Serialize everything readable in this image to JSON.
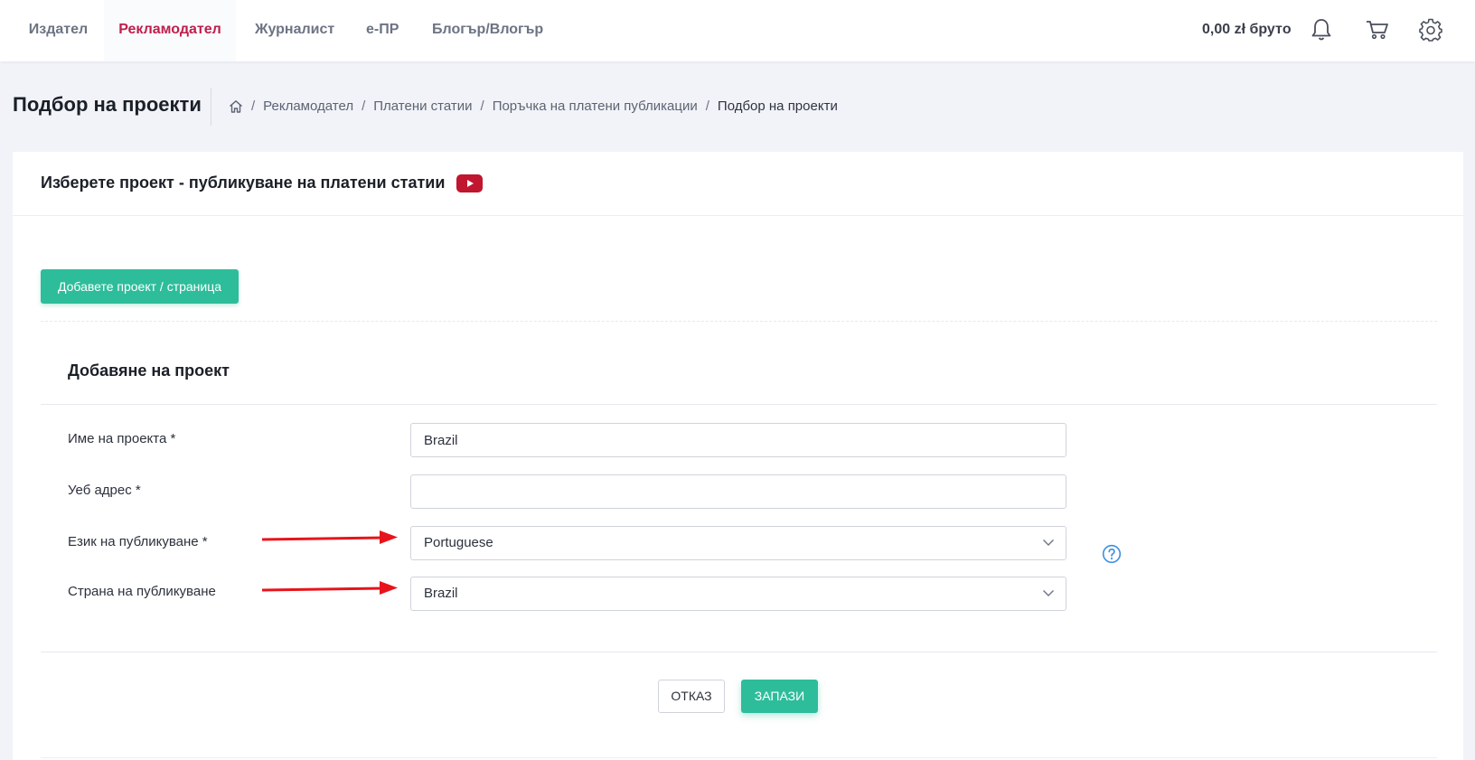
{
  "nav": {
    "tabs": [
      {
        "label": "Издател"
      },
      {
        "label": "Рекламодател",
        "active": true
      },
      {
        "label": "Журналист"
      },
      {
        "label": "e-ПР"
      },
      {
        "label": "Блогър/Влогър"
      }
    ],
    "balance": "0,00 zł брутo",
    "icons": [
      "bell-icon",
      "cart-icon",
      "gear-icon"
    ]
  },
  "page": {
    "title": "Подбор на проекти",
    "breadcrumb": [
      "Рекламодател",
      "Платени статии",
      "Поръчка на платени публикации",
      "Подбор на проекти"
    ]
  },
  "card": {
    "title": "Изберете проект - публикуване на платени статии",
    "add_button": "Добавете проект / страница",
    "section_title": "Добавяне на проект",
    "fields": {
      "project_name": {
        "label": "Име на проекта *",
        "value": "Brazil"
      },
      "web_address": {
        "label": "Уеб адрес *",
        "value": ""
      },
      "language": {
        "label": "Език на публикуване *",
        "value": "Portuguese"
      },
      "country": {
        "label": "Страна на публикуване",
        "value": "Brazil"
      }
    },
    "cancel_button": "ОТКАЗ",
    "save_button": "ЗАПАЗИ"
  },
  "colors": {
    "accent": "#bf1e4b",
    "primary": "#2ebd9b",
    "arrow": "#e8141b",
    "help": "#3d8fe0"
  }
}
